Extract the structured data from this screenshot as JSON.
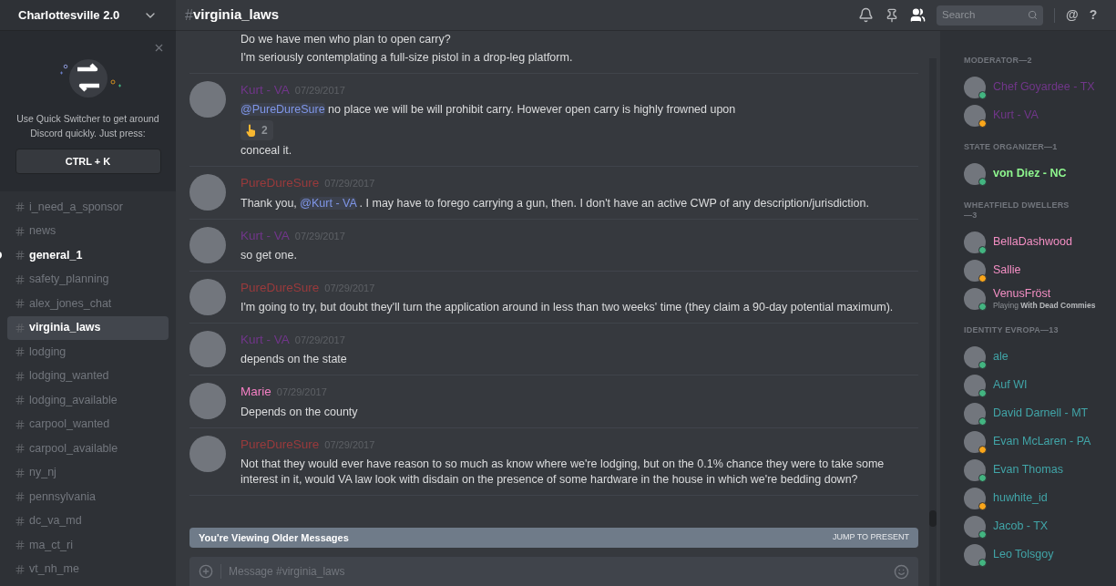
{
  "server": {
    "name": "Charlottesville 2.0"
  },
  "quick_switcher": {
    "text": "Use Quick Switcher to get around Discord quickly. Just press:",
    "shortcut": "CTRL + K"
  },
  "channels": [
    {
      "name": "i_need_a_sponsor",
      "selected": false,
      "unread": false
    },
    {
      "name": "news",
      "selected": false,
      "unread": false
    },
    {
      "name": "general_1",
      "selected": false,
      "unread": true
    },
    {
      "name": "safety_planning",
      "selected": false,
      "unread": false
    },
    {
      "name": "alex_jones_chat",
      "selected": false,
      "unread": false
    },
    {
      "name": "virginia_laws",
      "selected": true,
      "unread": false
    },
    {
      "name": "lodging",
      "selected": false,
      "unread": false
    },
    {
      "name": "lodging_wanted",
      "selected": false,
      "unread": false
    },
    {
      "name": "lodging_available",
      "selected": false,
      "unread": false
    },
    {
      "name": "carpool_wanted",
      "selected": false,
      "unread": false
    },
    {
      "name": "carpool_available",
      "selected": false,
      "unread": false
    },
    {
      "name": "ny_nj",
      "selected": false,
      "unread": false
    },
    {
      "name": "pennsylvania",
      "selected": false,
      "unread": false
    },
    {
      "name": "dc_va_md",
      "selected": false,
      "unread": false
    },
    {
      "name": "ma_ct_ri",
      "selected": false,
      "unread": false
    },
    {
      "name": "vt_nh_me",
      "selected": false,
      "unread": false
    }
  ],
  "header": {
    "hash": "#",
    "channel": "virginia_laws",
    "search_placeholder": "Search",
    "mention_glyph": "@",
    "help_glyph": "?"
  },
  "messages": [
    {
      "lines": [
        [
          {
            "kind": "text",
            "text": "Do we have men who plan to open carry?"
          }
        ],
        [
          {
            "kind": "text",
            "text": "I'm seriously contemplating a full-size pistol in a drop-leg platform."
          }
        ]
      ]
    },
    {
      "author": "Kurt - VA",
      "color": "#71368a",
      "time": "07/29/2017",
      "lines": [
        [
          {
            "kind": "mention",
            "text": "@PureDureSure"
          },
          {
            "kind": "text",
            "text": " no place we will be will prohibit carry. However open carry is highly frowned upon"
          }
        ]
      ],
      "reaction": {
        "count": "2"
      },
      "after": [
        [
          {
            "kind": "text",
            "text": "conceal it."
          }
        ]
      ]
    },
    {
      "author": "PureDureSure",
      "color": "#9a3a3c",
      "time": "07/29/2017",
      "lines": [
        [
          {
            "kind": "text",
            "text": "Thank you, "
          },
          {
            "kind": "mention",
            "text": "@Kurt - VA"
          },
          {
            "kind": "text",
            "text": " . I may have to forego carrying a gun, then. I don't have an active CWP of any description/jurisdiction."
          }
        ]
      ]
    },
    {
      "author": "Kurt - VA",
      "color": "#71368a",
      "time": "07/29/2017",
      "lines": [
        [
          {
            "kind": "text",
            "text": "so get one."
          }
        ]
      ]
    },
    {
      "author": "PureDureSure",
      "color": "#9a3a3c",
      "time": "07/29/2017",
      "lines": [
        [
          {
            "kind": "text",
            "text": "I'm going to try, but doubt they'll turn the application around in less than two weeks' time (they claim a 90-day potential maximum)."
          }
        ]
      ]
    },
    {
      "author": "Kurt - VA",
      "color": "#71368a",
      "time": "07/29/2017",
      "lines": [
        [
          {
            "kind": "text",
            "text": "depends on the state"
          }
        ]
      ]
    },
    {
      "author": "Marie",
      "color": "#f47fc4",
      "time": "07/29/2017",
      "lines": [
        [
          {
            "kind": "text",
            "text": "Depends on the county"
          }
        ]
      ]
    },
    {
      "author": "PureDureSure",
      "color": "#9a3a3c",
      "time": "07/29/2017",
      "lines": [
        [
          {
            "kind": "text",
            "text": "Not that they would ever have reason to so much as know where we're lodging, but on the 0.1% chance they were to take some interest in it, would VA law look with disdain on the presence of some hardware in the house in which we're bedding down?"
          }
        ]
      ]
    }
  ],
  "older_banner": {
    "text": "You're Viewing Older Messages",
    "action": "JUMP TO PRESENT"
  },
  "composer": {
    "placeholder": "Message #virginia_laws"
  },
  "member_groups": [
    {
      "title": "MODERATOR—2",
      "members": [
        {
          "name": "Chef Goyardee - TX",
          "color": "#71368a",
          "idle": false,
          "bold": false
        },
        {
          "name": "Kurt - VA",
          "color": "#71368a",
          "idle": true,
          "bold": false
        }
      ]
    },
    {
      "title": "STATE ORGANIZER—1",
      "members": [
        {
          "name": "von Diez - NC",
          "color": "#8ef58e",
          "idle": false,
          "bold": true
        }
      ]
    },
    {
      "title": "WHEATFIELD DWELLERS—3",
      "members": [
        {
          "name": "BellaDashwood",
          "color": "#f48fc4",
          "idle": false,
          "bold": false
        },
        {
          "name": "Sallie",
          "color": "#f48fc4",
          "idle": true,
          "bold": false
        },
        {
          "name": "VenusFröst",
          "color": "#f48fc4",
          "idle": false,
          "bold": false,
          "activity": "Playing **With Dead Commies**"
        }
      ]
    },
    {
      "title": "IDENTITY EVROPA—13",
      "members": [
        {
          "name": "ale",
          "color": "#41a5a8",
          "idle": false,
          "bold": false
        },
        {
          "name": "Auf WI",
          "color": "#41a5a8",
          "idle": false,
          "bold": false
        },
        {
          "name": "David Darnell - MT",
          "color": "#41a5a8",
          "idle": false,
          "bold": false
        },
        {
          "name": "Evan McLaren - PA",
          "color": "#41a5a8",
          "idle": true,
          "bold": false
        },
        {
          "name": "Evan Thomas",
          "color": "#41a5a8",
          "idle": false,
          "bold": false
        },
        {
          "name": "huwhite_id",
          "color": "#41a5a8",
          "idle": true,
          "bold": false
        },
        {
          "name": "Jacob - TX",
          "color": "#41a5a8",
          "idle": false,
          "bold": false
        },
        {
          "name": "Leo Tolsgoy",
          "color": "#41a5a8",
          "idle": false,
          "bold": false
        }
      ]
    }
  ]
}
